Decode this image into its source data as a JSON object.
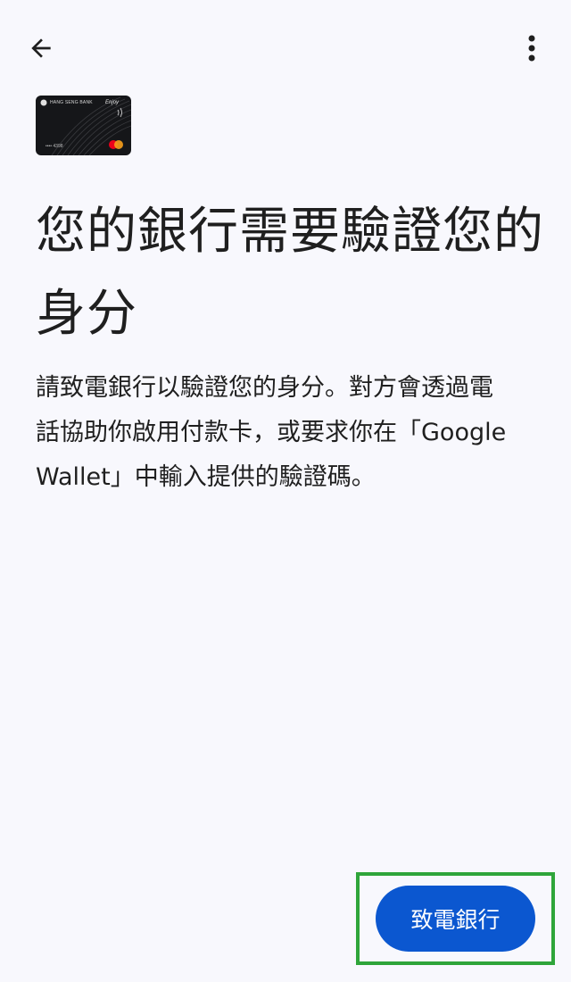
{
  "header": {
    "back_icon": "arrow-back-icon",
    "menu_icon": "more-vert-icon"
  },
  "card": {
    "bank_name": "HANG SENG BANK",
    "brand": "Enjoy",
    "last_digits": "•••• 4398",
    "network_icon": "mastercard-logo"
  },
  "main": {
    "title": "您的銀行需要驗證您的身分",
    "description": "請致電銀行以驗證您的身分。對方會透過電話協助你啟用付款卡，或要求你在「Google Wallet」中輸入提供的驗證碼。"
  },
  "footer": {
    "call_bank_label": "致電銀行"
  },
  "colors": {
    "background": "#F8F8FD",
    "primary_button": "#0B57D0",
    "text": "#1F1F1F",
    "highlight_border": "#2FA53A"
  }
}
